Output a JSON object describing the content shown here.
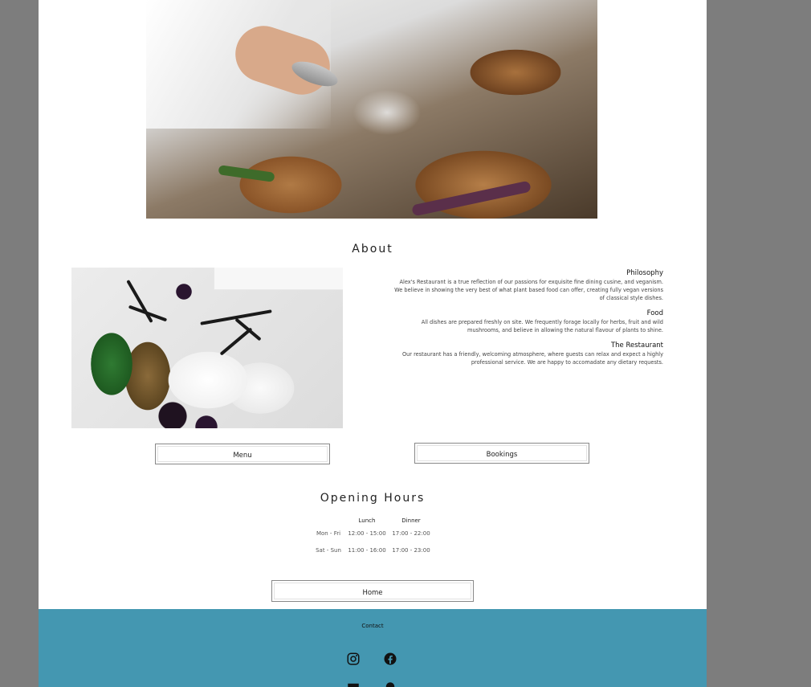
{
  "about": {
    "title": "About",
    "sections": [
      {
        "heading": "Philosophy",
        "text": "Alex's Restaurant is a true reflection of our passions for exquisite fine dining cusine, and veganism. We believe in showing the very best of what plant based food can offer, creating fully vegan versions of classical style dishes."
      },
      {
        "heading": "Food",
        "text": "All dishes are prepared freshly on site. We frequently forage locally for herbs, fruit and wild mushrooms, and believe in allowing the natural flavour of plants to shine."
      },
      {
        "heading": "The Restaurant",
        "text": "Our restaurant has a friendly, welcoming atmosphere, where guests can relax and expect a highly professional service. We are happy to accomadate any dietary requests."
      }
    ]
  },
  "buttons": {
    "menu": "Menu",
    "bookings": "Bookings",
    "home": "Home"
  },
  "hours": {
    "title": "Opening Hours",
    "columns": [
      "Lunch",
      "Dinner"
    ],
    "rows": [
      {
        "days": "Mon - Fri",
        "lunch": "12:00 - 15:00",
        "dinner": "17:00 - 22:00"
      },
      {
        "days": "Sat - Sun",
        "lunch": "11:00 - 16:00",
        "dinner": "17:00 - 23:00"
      }
    ]
  },
  "footer": {
    "contact": "Contact",
    "icons": [
      "instagram-icon",
      "facebook-icon",
      "email-icon",
      "location-icon"
    ],
    "background": "#4497b1"
  }
}
